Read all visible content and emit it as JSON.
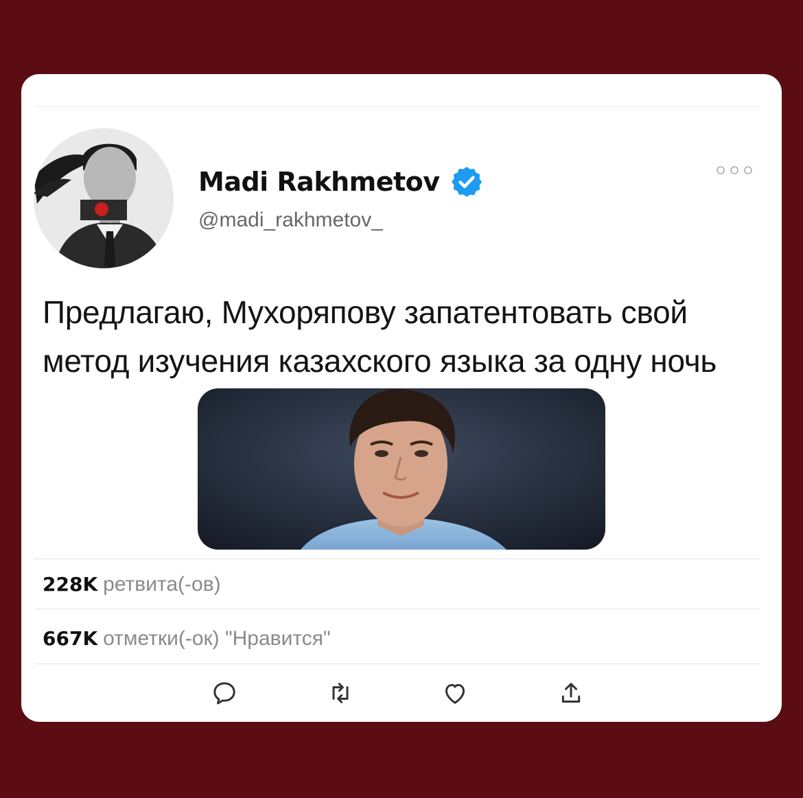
{
  "tweet": {
    "author_name": "Madi Rakhmetov",
    "author_handle": "@madi_rakhmetov_",
    "verified": true,
    "text_line1": "Предлагаю, Мухоряпову запатентовать свой",
    "text_line2": "метод изучения казахского языка за одну ночь",
    "retweets": {
      "count": "228K",
      "label": "ретвита(-ов)"
    },
    "likes": {
      "count": "667K",
      "label": "отметки(-ок) \"Нравится\""
    },
    "actions": [
      "reply-icon",
      "retweet-icon",
      "like-icon",
      "share-icon"
    ]
  },
  "colors": {
    "background": "#5b0d13",
    "card": "#ffffff",
    "verified": "#1d9bf0",
    "muted_text": "#8a8a8a"
  }
}
